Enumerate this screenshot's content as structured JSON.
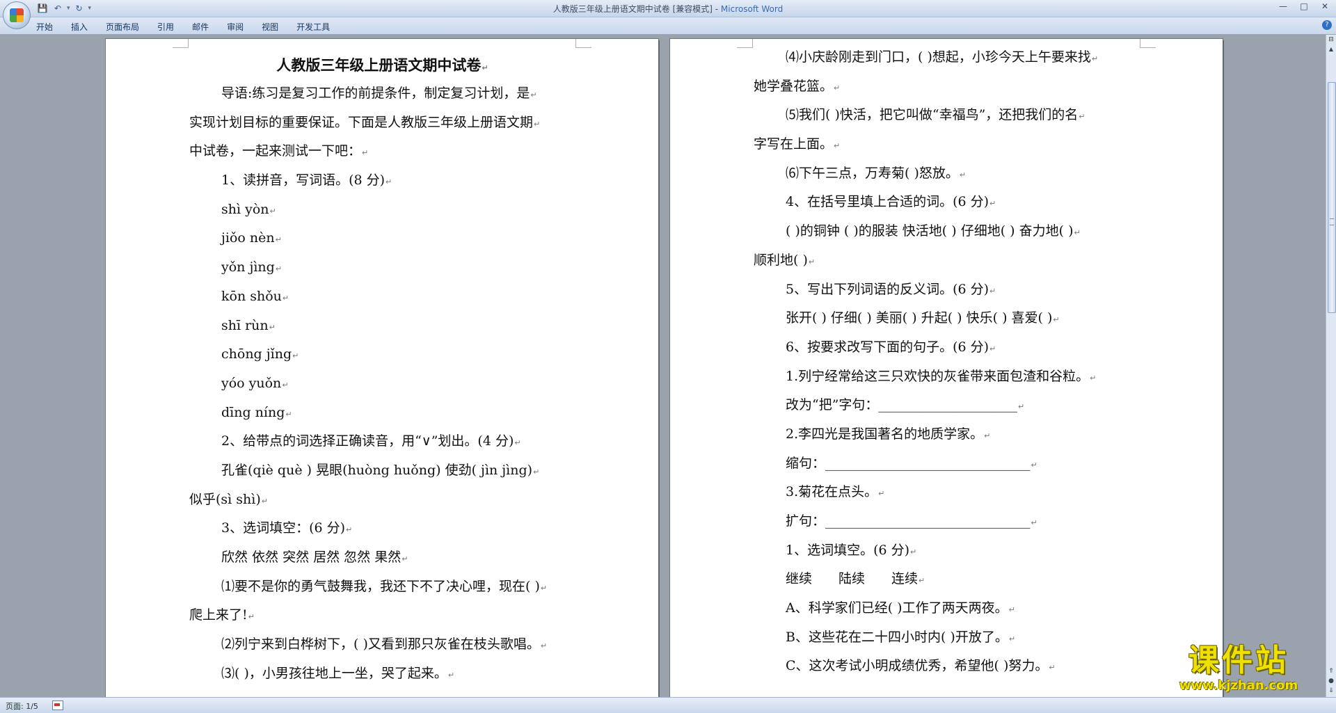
{
  "window": {
    "title": "人教版三年级上册语文期中试卷 [兼容模式] - ",
    "app_name": "Microsoft Word"
  },
  "quick_access": {
    "save_icon": "💾",
    "undo_icon": "↶",
    "redo_icon": "↻",
    "more_icon": "▾"
  },
  "ribbon": {
    "tabs": [
      "开始",
      "插入",
      "页面布局",
      "引用",
      "邮件",
      "审阅",
      "视图",
      "开发工具"
    ],
    "help_icon": "?"
  },
  "window_controls": {
    "minimize": "—",
    "maximize": "□",
    "close": "✕"
  },
  "document": {
    "title": "人教版三年级上册语文期中试卷",
    "left_page": [
      {
        "text": "导语:练习是复习工作的前提条件，制定复习计划，是",
        "indent": true
      },
      {
        "text": "实现计划目标的重要保证。下面是人教版三年级上册语文期",
        "indent": false
      },
      {
        "text": "中试卷，一起来测试一下吧：",
        "indent": false
      },
      {
        "text": "1、读拼音，写词语。(8 分)",
        "indent": true
      },
      {
        "text": "shì yòn",
        "indent": true
      },
      {
        "text": "jiǒo nèn",
        "indent": true
      },
      {
        "text": "yǒn jìng",
        "indent": true
      },
      {
        "text": "kōn shǒu",
        "indent": true
      },
      {
        "text": "shī rùn",
        "indent": true
      },
      {
        "text": "chōng jǐng",
        "indent": true
      },
      {
        "text": "yóo yuǒn",
        "indent": true
      },
      {
        "text": "dīng níng",
        "indent": true
      },
      {
        "text": "2、给带点的词选择正确读音，用“∨”划出。(4 分)",
        "indent": true
      },
      {
        "text": "孔雀(qiè què ) 晃眼(huòng huǒng) 使劲( jìn jìng)",
        "indent": true
      },
      {
        "text": "似乎(sì shì)",
        "indent": false
      },
      {
        "text": "3、选词填空：(6 分)",
        "indent": true
      },
      {
        "text": "欣然 依然 突然 居然 忽然 果然",
        "indent": true
      },
      {
        "text": "⑴要不是你的勇气鼓舞我，我还下不了决心哩，现在( )",
        "indent": true
      },
      {
        "text": "爬上来了!",
        "indent": false
      },
      {
        "text": "⑵列宁来到白桦树下，( )又看到那只灰雀在枝头歌唱。",
        "indent": true
      },
      {
        "text": "⑶( )，小男孩往地上一坐，哭了起来。",
        "indent": true
      }
    ],
    "right_page": [
      {
        "text": "⑷小庆龄刚走到门口，( )想起，小珍今天上午要来找",
        "indent": true
      },
      {
        "text": "她学叠花篮。",
        "indent": false
      },
      {
        "text": "⑸我们( )快活，把它叫做“幸福鸟”，还把我们的名",
        "indent": true
      },
      {
        "text": "字写在上面。",
        "indent": false
      },
      {
        "text": "⑹下午三点，万寿菊( )怒放。",
        "indent": true
      },
      {
        "text": "4、在括号里填上合适的词。(6 分)",
        "indent": true
      },
      {
        "text": "( )的铜钟 ( )的服装 快活地( ) 仔细地( ) 奋力地( )",
        "indent": true
      },
      {
        "text": "顺利地( )",
        "indent": false
      },
      {
        "text": "5、写出下列词语的反义词。(6 分)",
        "indent": true
      },
      {
        "text": "张开( ) 仔细( ) 美丽( ) 升起( ) 快乐( ) 喜爱( )",
        "indent": true
      },
      {
        "text": "6、按要求改写下面的句子。(6 分)",
        "indent": true
      },
      {
        "text": "1.列宁经常给这三只欢快的灰雀带来面包渣和谷粒。",
        "indent": true
      },
      {
        "text": "改为“把”字句：_____________________",
        "indent": true
      },
      {
        "text": "2.李四光是我国著名的地质学家。",
        "indent": true
      },
      {
        "text": "缩句：_______________________________",
        "indent": true
      },
      {
        "text": "3.菊花在点头。",
        "indent": true
      },
      {
        "text": "扩句：_______________________________",
        "indent": true
      },
      {
        "text": "1、选词填空。(6 分)",
        "indent": true
      },
      {
        "text": "继续　　陆续　　连续",
        "indent": true
      },
      {
        "text": "A、科学家们已经( )工作了两天两夜。",
        "indent": true
      },
      {
        "text": "B、这些花在二十四小时内( )开放了。",
        "indent": true
      },
      {
        "text": "C、这次考试小明成绩优秀，希望他( )努力。",
        "indent": true
      }
    ],
    "paragraph_mark": "↵"
  },
  "statusbar": {
    "page_info": "页面: 1/5"
  },
  "watermark": {
    "text": "课件站",
    "url": "www.kjzhan.com"
  }
}
